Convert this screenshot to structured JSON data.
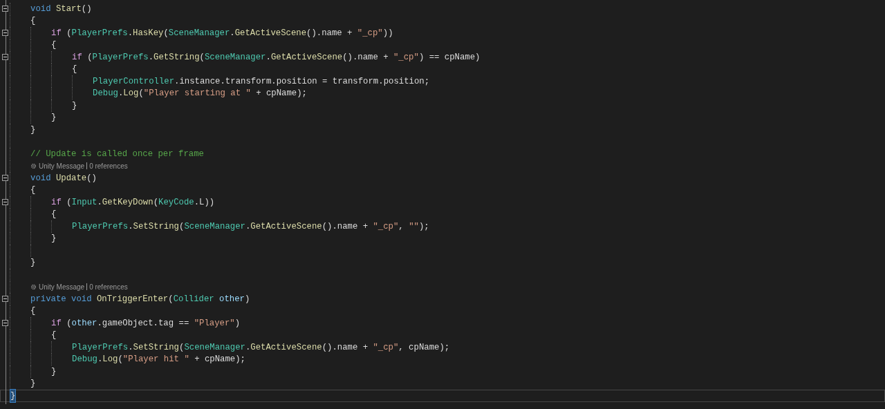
{
  "class_body": [
    {
      "kind": "code",
      "current": false,
      "expanded": true,
      "tokens": [
        {
          "kind": "keyword",
          "text": "void "
        },
        {
          "kind": "method",
          "text": "Start"
        },
        {
          "kind": "plain",
          "text": "()"
        }
      ]
    },
    {
      "kind": "code",
      "current": false,
      "tokens": [
        {
          "kind": "plain",
          "text": "{"
        }
      ],
      "children": [
        {
          "kind": "code",
          "current": false,
          "expanded": true,
          "tokens": [
            {
              "kind": "control",
              "text": "if"
            },
            {
              "kind": "plain",
              "text": " ("
            },
            {
              "kind": "type",
              "text": "PlayerPrefs"
            },
            {
              "kind": "plain",
              "text": "."
            },
            {
              "kind": "method",
              "text": "HasKey"
            },
            {
              "kind": "plain",
              "text": "("
            },
            {
              "kind": "type",
              "text": "SceneManager"
            },
            {
              "kind": "plain",
              "text": "."
            },
            {
              "kind": "method",
              "text": "GetActiveScene"
            },
            {
              "kind": "plain",
              "text": "().name + "
            },
            {
              "kind": "string",
              "text": "\"_cp\""
            },
            {
              "kind": "plain",
              "text": "))"
            }
          ]
        },
        {
          "kind": "code",
          "current": false,
          "tokens": [
            {
              "kind": "plain",
              "text": "{"
            }
          ],
          "children": [
            {
              "kind": "code",
              "current": false,
              "expanded": true,
              "tokens": [
                {
                  "kind": "control",
                  "text": "if"
                },
                {
                  "kind": "plain",
                  "text": " ("
                },
                {
                  "kind": "type",
                  "text": "PlayerPrefs"
                },
                {
                  "kind": "plain",
                  "text": "."
                },
                {
                  "kind": "method",
                  "text": "GetString"
                },
                {
                  "kind": "plain",
                  "text": "("
                },
                {
                  "kind": "type",
                  "text": "SceneManager"
                },
                {
                  "kind": "plain",
                  "text": "."
                },
                {
                  "kind": "method",
                  "text": "GetActiveScene"
                },
                {
                  "kind": "plain",
                  "text": "().name + "
                },
                {
                  "kind": "string",
                  "text": "\"_cp\""
                },
                {
                  "kind": "plain",
                  "text": ") == cpName)"
                }
              ]
            },
            {
              "kind": "code",
              "current": false,
              "tokens": [
                {
                  "kind": "plain",
                  "text": "{"
                }
              ],
              "children": [
                {
                  "kind": "code",
                  "current": false,
                  "tokens": [
                    {
                      "kind": "type",
                      "text": "PlayerController"
                    },
                    {
                      "kind": "plain",
                      "text": ".instance.transform.position = transform.position;"
                    }
                  ]
                },
                {
                  "kind": "code",
                  "current": false,
                  "tokens": [
                    {
                      "kind": "type",
                      "text": "Debug"
                    },
                    {
                      "kind": "plain",
                      "text": "."
                    },
                    {
                      "kind": "method",
                      "text": "Log"
                    },
                    {
                      "kind": "plain",
                      "text": "("
                    },
                    {
                      "kind": "string",
                      "text": "\"Player starting at \""
                    },
                    {
                      "kind": "plain",
                      "text": " + cpName);"
                    }
                  ]
                }
              ]
            },
            {
              "kind": "code",
              "current": false,
              "tokens": [
                {
                  "kind": "plain",
                  "text": "}"
                }
              ]
            }
          ]
        },
        {
          "kind": "code",
          "current": false,
          "tokens": [
            {
              "kind": "plain",
              "text": "}"
            }
          ]
        }
      ]
    },
    {
      "kind": "code",
      "current": false,
      "tokens": [
        {
          "kind": "plain",
          "text": "}"
        }
      ]
    },
    {
      "kind": "blank",
      "current": false
    },
    {
      "kind": "code",
      "current": false,
      "tokens": [
        {
          "kind": "comment",
          "text": "// Update is called once per frame"
        }
      ]
    },
    {
      "kind": "codelens",
      "current": false,
      "parts": [
        "Unity Message",
        "0 references"
      ]
    },
    {
      "kind": "code",
      "current": false,
      "expanded": true,
      "tokens": [
        {
          "kind": "keyword",
          "text": "void "
        },
        {
          "kind": "method",
          "text": "Update"
        },
        {
          "kind": "plain",
          "text": "()"
        }
      ]
    },
    {
      "kind": "code",
      "current": false,
      "tokens": [
        {
          "kind": "plain",
          "text": "{"
        }
      ],
      "children": [
        {
          "kind": "code",
          "current": false,
          "expanded": true,
          "tokens": [
            {
              "kind": "control",
              "text": "if"
            },
            {
              "kind": "plain",
              "text": " ("
            },
            {
              "kind": "type",
              "text": "Input"
            },
            {
              "kind": "plain",
              "text": "."
            },
            {
              "kind": "method",
              "text": "GetKeyDown"
            },
            {
              "kind": "plain",
              "text": "("
            },
            {
              "kind": "type",
              "text": "KeyCode"
            },
            {
              "kind": "plain",
              "text": ".L))"
            }
          ]
        },
        {
          "kind": "code",
          "current": false,
          "tokens": [
            {
              "kind": "plain",
              "text": "{"
            }
          ],
          "children": [
            {
              "kind": "code",
              "current": false,
              "tokens": [
                {
                  "kind": "type",
                  "text": "PlayerPrefs"
                },
                {
                  "kind": "plain",
                  "text": "."
                },
                {
                  "kind": "method",
                  "text": "SetString"
                },
                {
                  "kind": "plain",
                  "text": "("
                },
                {
                  "kind": "type",
                  "text": "SceneManager"
                },
                {
                  "kind": "plain",
                  "text": "."
                },
                {
                  "kind": "method",
                  "text": "GetActiveScene"
                },
                {
                  "kind": "plain",
                  "text": "().name + "
                },
                {
                  "kind": "string",
                  "text": "\"_cp\""
                },
                {
                  "kind": "plain",
                  "text": ", "
                },
                {
                  "kind": "string",
                  "text": "\"\""
                },
                {
                  "kind": "plain",
                  "text": ");"
                }
              ]
            }
          ]
        },
        {
          "kind": "code",
          "current": false,
          "tokens": [
            {
              "kind": "plain",
              "text": "}"
            }
          ]
        },
        {
          "kind": "blank",
          "current": false
        }
      ]
    },
    {
      "kind": "code",
      "current": false,
      "tokens": [
        {
          "kind": "plain",
          "text": "}"
        }
      ]
    },
    {
      "kind": "blank",
      "current": false
    },
    {
      "kind": "codelens",
      "current": false,
      "parts": [
        "Unity Message",
        "0 references"
      ]
    },
    {
      "kind": "code",
      "current": false,
      "expanded": true,
      "tokens": [
        {
          "kind": "keyword",
          "text": "private void "
        },
        {
          "kind": "method",
          "text": "OnTriggerEnter"
        },
        {
          "kind": "plain",
          "text": "("
        },
        {
          "kind": "type",
          "text": "Collider "
        },
        {
          "kind": "variable",
          "text": "other"
        },
        {
          "kind": "plain",
          "text": ")"
        }
      ]
    },
    {
      "kind": "code",
      "current": false,
      "tokens": [
        {
          "kind": "plain",
          "text": "{"
        }
      ],
      "children": [
        {
          "kind": "code",
          "current": false,
          "expanded": true,
          "tokens": [
            {
              "kind": "control",
              "text": "if"
            },
            {
              "kind": "plain",
              "text": " ("
            },
            {
              "kind": "variable",
              "text": "other"
            },
            {
              "kind": "plain",
              "text": ".gameObject.tag == "
            },
            {
              "kind": "string",
              "text": "\"Player\""
            },
            {
              "kind": "plain",
              "text": ")"
            }
          ]
        },
        {
          "kind": "code",
          "current": false,
          "tokens": [
            {
              "kind": "plain",
              "text": "{"
            }
          ],
          "children": [
            {
              "kind": "code",
              "current": false,
              "tokens": [
                {
                  "kind": "type",
                  "text": "PlayerPrefs"
                },
                {
                  "kind": "plain",
                  "text": "."
                },
                {
                  "kind": "method",
                  "text": "SetString"
                },
                {
                  "kind": "plain",
                  "text": "("
                },
                {
                  "kind": "type",
                  "text": "SceneManager"
                },
                {
                  "kind": "plain",
                  "text": "."
                },
                {
                  "kind": "method",
                  "text": "GetActiveScene"
                },
                {
                  "kind": "plain",
                  "text": "().name + "
                },
                {
                  "kind": "string",
                  "text": "\"_cp\""
                },
                {
                  "kind": "plain",
                  "text": ", cpName);"
                }
              ]
            },
            {
              "kind": "code",
              "current": false,
              "tokens": [
                {
                  "kind": "type",
                  "text": "Debug"
                },
                {
                  "kind": "plain",
                  "text": "."
                },
                {
                  "kind": "method",
                  "text": "Log"
                },
                {
                  "kind": "plain",
                  "text": "("
                },
                {
                  "kind": "string",
                  "text": "\"Player hit \""
                },
                {
                  "kind": "plain",
                  "text": " + cpName);"
                }
              ]
            }
          ]
        },
        {
          "kind": "code",
          "current": false,
          "tokens": [
            {
              "kind": "plain",
              "text": "}"
            }
          ]
        }
      ]
    },
    {
      "kind": "code",
      "current": false,
      "tokens": [
        {
          "kind": "plain",
          "text": "}"
        }
      ]
    }
  ],
  "closing_line": {
    "kind": "code",
    "current": true,
    "tokens": [
      {
        "kind": "plain",
        "text": "}"
      }
    ]
  }
}
